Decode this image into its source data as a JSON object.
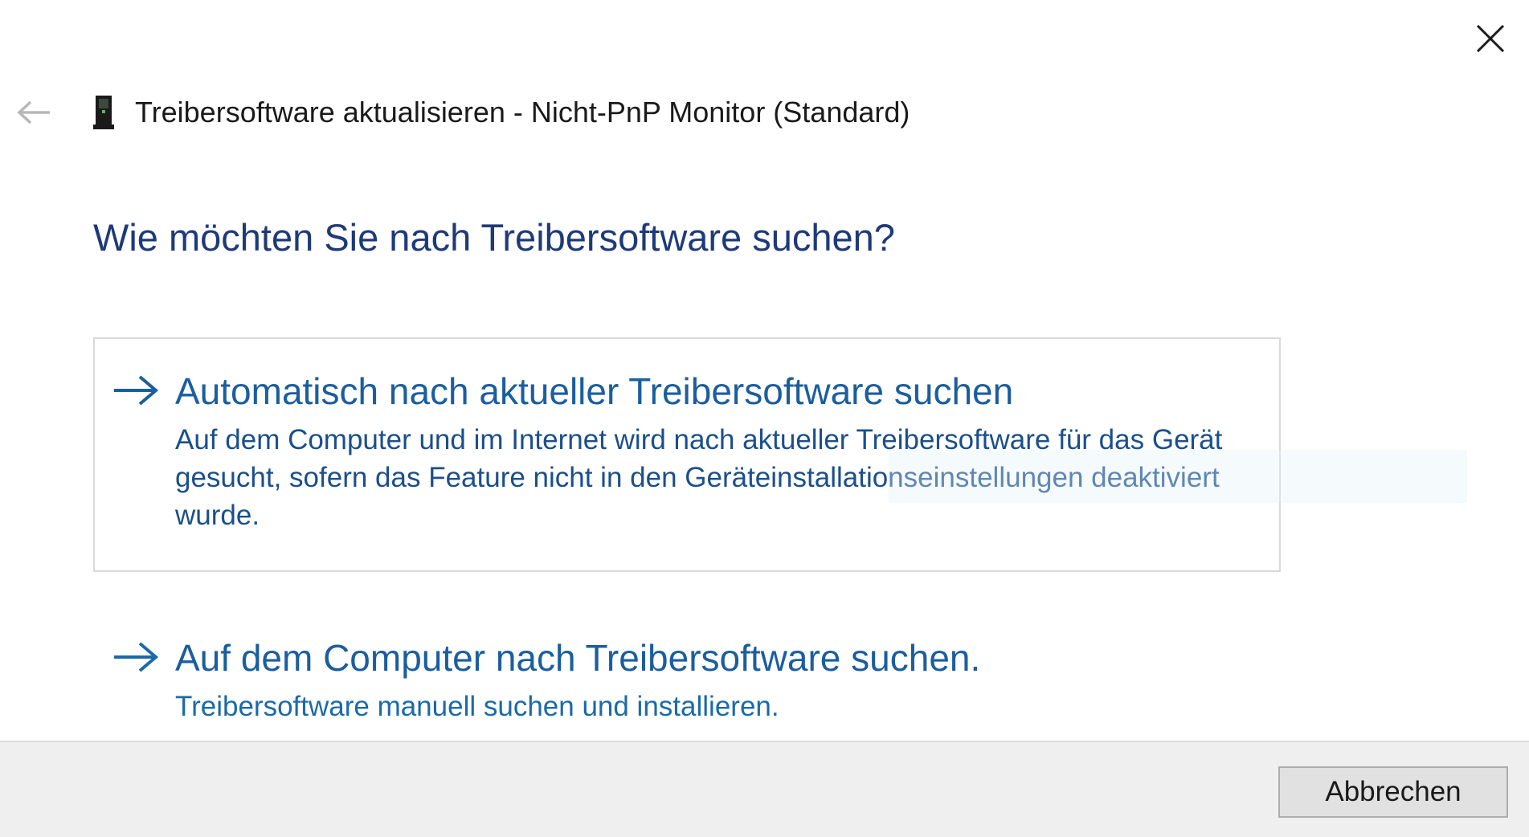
{
  "window": {
    "title": "Treibersoftware aktualisieren - Nicht-PnP Monitor (Standard)",
    "close_icon": "close-icon",
    "back_icon": "back-arrow-icon",
    "device_icon": "monitor-device-icon"
  },
  "main": {
    "question": "Wie möchten Sie nach Treibersoftware suchen?",
    "options": [
      {
        "icon": "arrow-right-icon",
        "title": "Automatisch nach aktueller Treibersoftware suchen",
        "description": "Auf dem Computer und im Internet wird nach aktueller Treibersoftware für das Gerät gesucht, sofern das Feature nicht in den Geräteinstallationseinstellungen deaktiviert wurde."
      },
      {
        "icon": "arrow-right-icon",
        "title": "Auf dem Computer nach Treibersoftware suchen.",
        "description": "Treibersoftware manuell suchen und installieren."
      }
    ]
  },
  "footer": {
    "cancel_label": "Abbrechen"
  },
  "colors": {
    "question": "#1e3a78",
    "option_title": "#1b5e9e",
    "footer_bg": "#efefef"
  }
}
